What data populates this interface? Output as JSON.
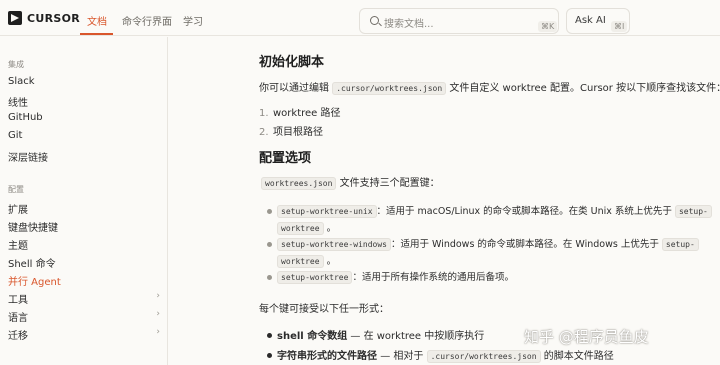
{
  "header": {
    "logo": "CURSOR",
    "tabs": [
      {
        "label": "文档"
      },
      {
        "label": "命令行界面"
      },
      {
        "label": "学习"
      }
    ],
    "search": {
      "placeholder": "搜索文档...",
      "shortcut": "⌘K"
    },
    "ask_ai": {
      "label": "Ask AI",
      "shortcut": "⌘I"
    }
  },
  "sidebar": {
    "section1": "集成",
    "items1": [
      {
        "label": "Slack"
      },
      {
        "label": "线性"
      },
      {
        "label": "GitHub"
      },
      {
        "label": "Git"
      },
      {
        "label": "深层链接"
      }
    ],
    "section2": "配置",
    "items2": [
      {
        "label": "扩展"
      },
      {
        "label": "键盘快捷键"
      },
      {
        "label": "主题"
      },
      {
        "label": "Shell 命令"
      },
      {
        "label": "并行 Agent"
      },
      {
        "label": "工具",
        "chevron": "›"
      },
      {
        "label": "语言",
        "chevron": "›"
      },
      {
        "label": "迁移",
        "chevron": "›"
      }
    ]
  },
  "main": {
    "h_init": "初始化脚本",
    "intro_pre": "你可以通过编辑",
    "intro_code": ".cursor/worktrees.json",
    "intro_post": "文件自定义 worktree 配置。Cursor 按以下顺序查找该文件：",
    "order": [
      {
        "num": "1.",
        "text": "worktree 路径"
      },
      {
        "num": "2.",
        "text": "项目根路径"
      }
    ],
    "h_config": "配置选项",
    "cfg_code": "worktrees.json",
    "cfg_post": "文件支持三个配置键：",
    "keys": [
      {
        "code": "setup-worktree-unix",
        "text": "：适用于 macOS/Linux 的命令或脚本路径。在类 Unix 系统上优先于",
        "code2": "setup-",
        "cont_code": "worktree",
        "cont_text": "。"
      },
      {
        "code": "setup-worktree-windows",
        "text": "：适用于 Windows 的命令或脚本路径。在 Windows 上优先于",
        "code2": "setup-",
        "cont_code": "worktree",
        "cont_text": "。"
      },
      {
        "code": "setup-worktree",
        "text": "：适用于所有操作系统的通用后备项。"
      }
    ],
    "forms_intro": "每个键可接受以下任一形式：",
    "forms": [
      {
        "bold": "shell 命令数组",
        "text": "— 在 worktree 中按顺序执行"
      },
      {
        "bold": "字符串形式的文件路径",
        "text": "— 相对于",
        "code": ".cursor/worktrees.json",
        "post": "的脚本文件路径"
      }
    ]
  },
  "watermark": "知乎 @程序员鱼皮",
  "colors": {
    "accent": "#d9562c",
    "background": "#fbfaf7"
  }
}
